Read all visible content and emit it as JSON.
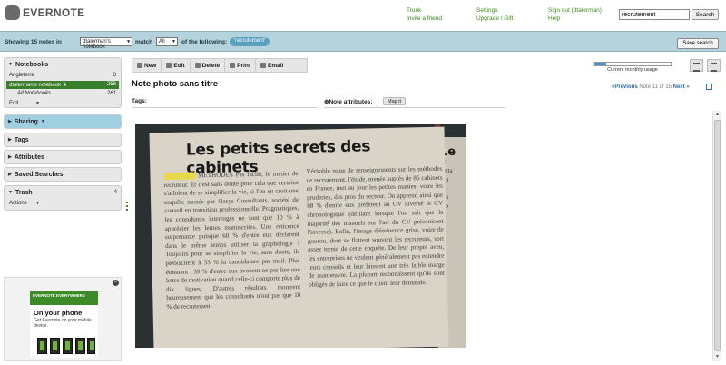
{
  "header": {
    "logo_text": "EVERNOTE",
    "links_col1": [
      "Trunk",
      "Invite a friend"
    ],
    "links_col2": [
      "Settings",
      "Upgrade / Gift"
    ],
    "links_col3": [
      "Sign out (dtalerman)",
      "Help"
    ],
    "search_value": "recrutement",
    "search_button": "Search"
  },
  "filter_bar": {
    "showing": "Showing 15 notes in",
    "notebook_select": "dtalerman's notebook",
    "match_label": "match",
    "match_select": "All",
    "of_following": "of the following:",
    "tag_chip": "\"recrutement\"",
    "save_search": "Save search"
  },
  "sidebar": {
    "notebooks": {
      "header": "Notebooks",
      "items": [
        {
          "label": "Angleterre",
          "count": "3"
        },
        {
          "label": "dtalerman's notebook ★",
          "count": "258"
        },
        {
          "label": "All Notebooks",
          "count": "261"
        }
      ],
      "edit": "Edit"
    },
    "sharing": "Sharing",
    "tags": "Tags",
    "attributes": "Attributes",
    "saved_searches": "Saved Searches",
    "trash": {
      "header": "Trash",
      "count": "4",
      "actions": "Actions"
    }
  },
  "ad": {
    "badge": "EVERNOTE EVERYWHERE",
    "title": "On your phone",
    "subtitle": "Get Evernote on your mobile device."
  },
  "toolbar": {
    "new": "New",
    "edit": "Edit",
    "delete": "Delete",
    "print": "Print",
    "email": "Email"
  },
  "usage": {
    "label": "Current monthly usage",
    "fraction": 0.15
  },
  "note": {
    "title": "Note photo sans titre",
    "pager_prev": "«Previous",
    "pager_status": "Note 11 of 15",
    "pager_next": "Next »",
    "tags_label": "Tags:",
    "attributes_label": "Note attributes:",
    "map_button": "Map it"
  },
  "photo": {
    "headline": "Les petits secrets des cabinets",
    "col1": "METHODES Pas facile, le métier de recruteur. Et c'est sans doute pour cela que certains s'affolent de se simplifier la vie, si l'on en croit une enquête menée par Oasys Consultants, société de conseil en transition professionnelle. Pragmatiques, les consultants interrogés ne sont que 10 % à apprécier les lettres manuscrites. Une réticence surprenante puisque 60 % d'entre eux déclarent dans le même temps utiliser la graphologie ! Toujours pour se simplifier la vie, sans doute, ils plébiscitent à 33 % la candidature par mail. Plus étonnant : 39 % d'entre eux avouent ne pas lire une lettre de motivation quand celle-ci comporte plus de dix lignes. D'autres résultats montrent heureusement que les consultants n'ont pas que 10 % de recrutement",
    "col2": "Véritable mine de renseignements sur les méthodes de recrutement, l'étude, menée auprès de 86 cabinets en France, met au jour les petites manies, voire les pruderies, des pros du secteur. On apprend ainsi que 88 % d'entre eux préfèrent au CV inversé le CV chronologique (défilant lorsque l'on sait que la majorité des manuels sur l'art du CV préconisent l'inverse). Enfin, l'image d'éminence grise, voire de gourou, dont se flattent souvent les recruteurs, sort assez ternie de cette enquête. De leur propre aveu, les entreprises ne veulent généralement pas entendre leurs conseils et leur laissent une très faible marge de manoeuvre. La plupart reconnaissent qu'ils sont obligés de faire ce que le client leur demande.",
    "strip": "Leé\nnd\ncerta\nsen\nun\nreu\nrep\nch"
  }
}
